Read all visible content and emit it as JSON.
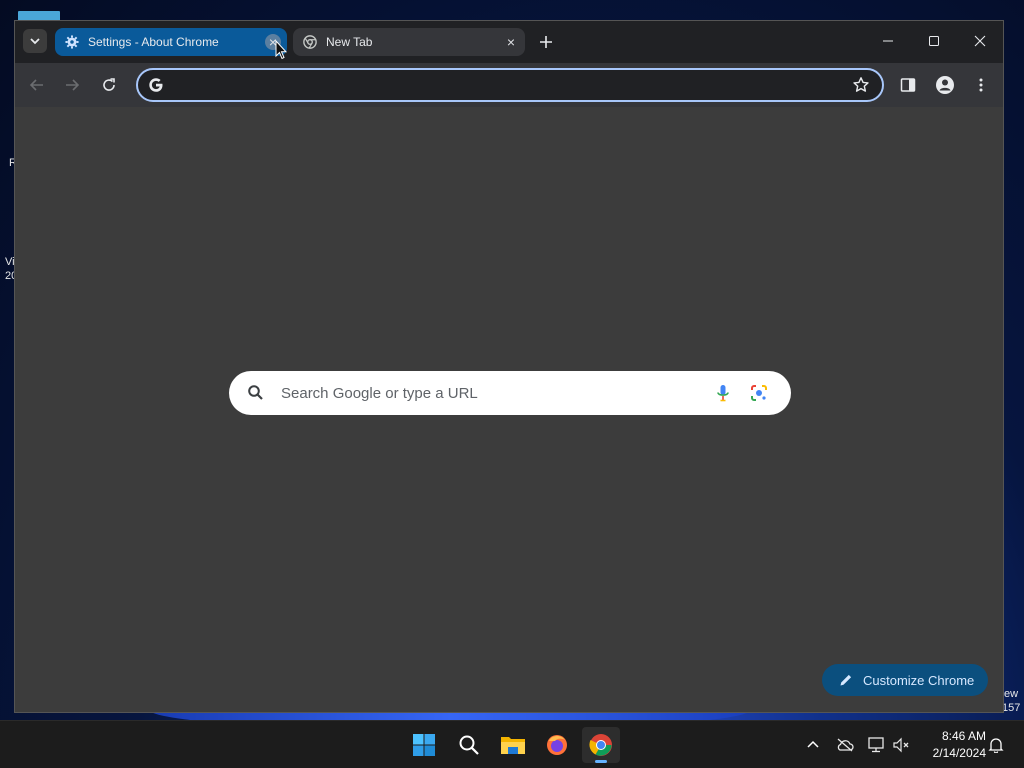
{
  "desktop": {
    "fragments": [
      {
        "id": "frag-r",
        "text": "R"
      },
      {
        "id": "frag-vi",
        "text": "Vi"
      },
      {
        "id": "frag-20",
        "text": "20"
      },
      {
        "id": "frag-ew",
        "text": "ew"
      },
      {
        "id": "frag-157",
        "text": "157"
      }
    ]
  },
  "browser": {
    "tabs": [
      {
        "title": "Settings - About Chrome",
        "icon": "gear-icon",
        "active": true
      },
      {
        "title": "New Tab",
        "icon": "chrome-icon",
        "active": false
      }
    ],
    "window_controls": {
      "minimize": "minimize-icon",
      "maximize": "maximize-icon",
      "close": "close-icon"
    },
    "omnibox": {
      "value": "",
      "placeholder": ""
    },
    "accent_color": "#a8c7fa"
  },
  "ntp": {
    "search_placeholder": "Search Google or type a URL",
    "customize_label": "Customize Chrome"
  },
  "taskbar": {
    "apps": [
      "start-icon",
      "search-icon",
      "file-explorer-icon",
      "firefox-icon",
      "chrome-icon"
    ],
    "time": "8:46 AM",
    "date": "2/14/2024"
  }
}
